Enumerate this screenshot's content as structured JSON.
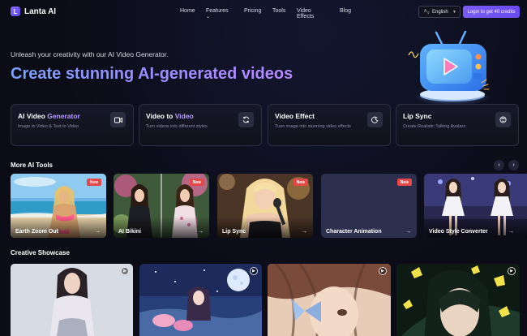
{
  "nav": {
    "logo_text": "Lanta AI",
    "logo_mark": "L",
    "menu": [
      "Home",
      "Features",
      "Pricing",
      "Tools",
      "Video Effects",
      "Blog"
    ],
    "features_chevron": "⌄",
    "language": "English",
    "login_label": "Login to get 40 credits"
  },
  "hero": {
    "subtitle": "Unleash your creativity with our AI Video Generator.",
    "title": "Create stunning AI-generated videos"
  },
  "features": [
    {
      "title_plain": "AI Video ",
      "title_hl": "Generator",
      "desc": "Image to Video & Text to Video",
      "icon": "video-camera-icon"
    },
    {
      "title_plain": "Video to ",
      "title_hl": "Video",
      "desc": "Turn videos into different styles",
      "icon": "refresh-icon"
    },
    {
      "title_plain": "Video Effect",
      "title_hl": "",
      "desc": "Tuen image into stunning video effects",
      "icon": "magic-moon-icon"
    },
    {
      "title_plain": "Lip Sync",
      "title_hl": "",
      "desc": "Create Realistic Talking Avatars",
      "icon": "face-icon"
    }
  ],
  "more_tools": {
    "title": "More AI Tools",
    "prev": "‹",
    "next": "›",
    "items": [
      {
        "label": "Earth Zoom Out",
        "badge": "New",
        "arrow": "→"
      },
      {
        "label": "AI Bikini",
        "badge": "New",
        "arrow": "→"
      },
      {
        "label": "Lip Sync",
        "badge": "New",
        "arrow": "→"
      },
      {
        "label": "Character Animation",
        "badge": "New",
        "arrow": "→"
      },
      {
        "label": "Video Style Converter",
        "badge": "",
        "arrow": "→"
      }
    ]
  },
  "showcase": {
    "title": "Creative Showcase",
    "play_icon": "▶"
  },
  "colors": {
    "accent": "#7a5cf5",
    "badge": "#e54848",
    "background": "#0b0c16"
  }
}
